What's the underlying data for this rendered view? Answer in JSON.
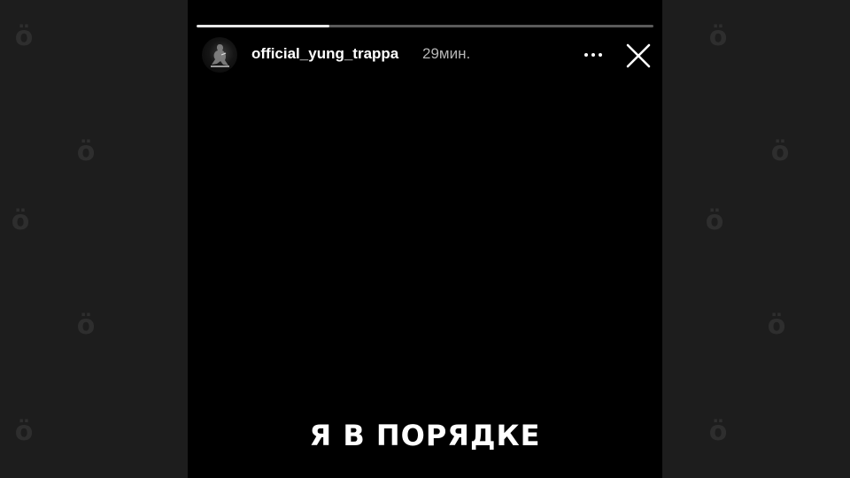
{
  "story": {
    "username": "official_yung_trappa",
    "time_ago": "29мин.",
    "caption": "Я В ПОРЯДКЕ",
    "progress_fraction": 0.29,
    "avatar_icon": "avatar-silhouette"
  },
  "controls": {
    "more_icon": "more-options-icon",
    "close_icon": "close-icon"
  },
  "watermark": {
    "glyph": "ö",
    "color": "#2e2e2e"
  },
  "colors": {
    "story_background": "#000000",
    "side_background": "#1d1d1d",
    "text_primary": "#ffffff",
    "text_secondary": "#b5b5b5",
    "progress_track": "#5a5a5a",
    "progress_fill": "#e8e8e8"
  }
}
